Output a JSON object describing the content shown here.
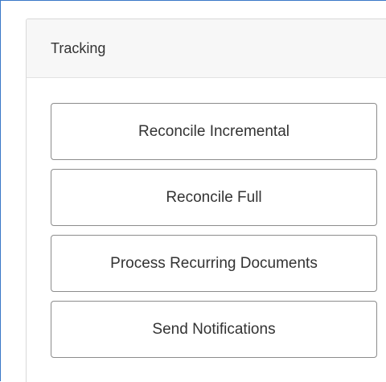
{
  "panel": {
    "title": "Tracking"
  },
  "actions": [
    {
      "label": "Reconcile Incremental"
    },
    {
      "label": "Reconcile Full"
    },
    {
      "label": "Process Recurring Documents"
    },
    {
      "label": "Send Notifications"
    }
  ]
}
